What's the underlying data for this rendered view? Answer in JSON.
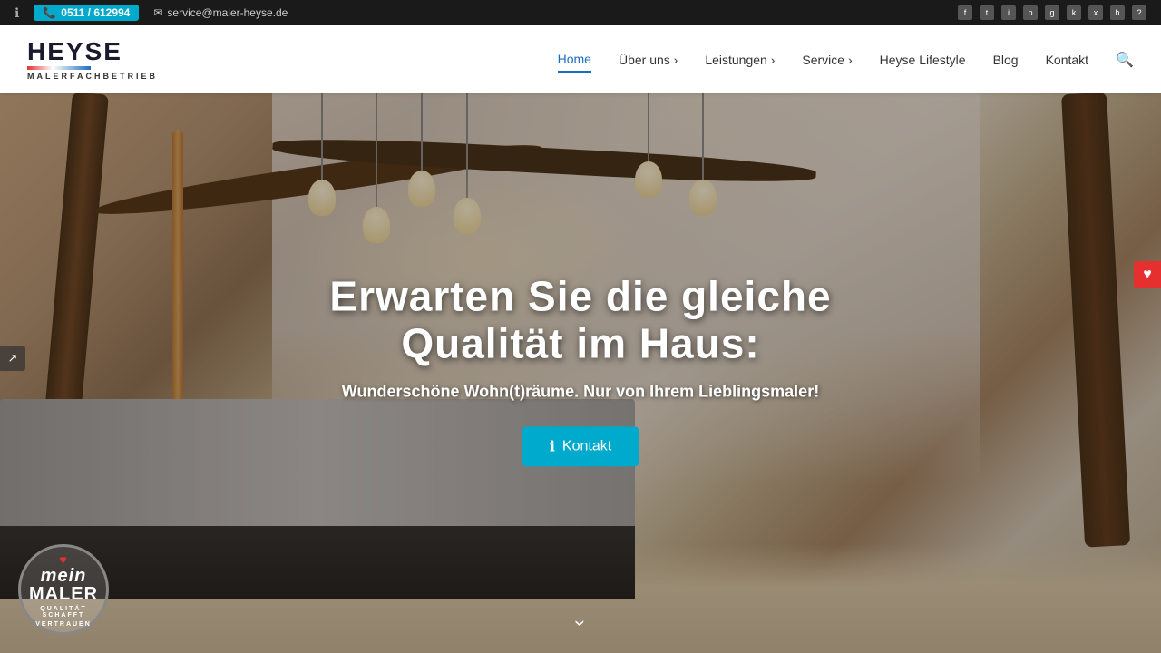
{
  "topbar": {
    "phone": "0511 / 612994",
    "email": "service@maler-heyse.de",
    "info_icon": "ℹ",
    "phone_icon": "📞",
    "email_icon": "✉",
    "socials": [
      "f",
      "t",
      "i",
      "p",
      "g",
      "k",
      "x",
      "h",
      "?"
    ]
  },
  "header": {
    "logo_name": "HEYSE",
    "logo_sub": "MALERFACHBETRIEB",
    "nav": [
      {
        "label": "Home",
        "active": true
      },
      {
        "label": "Über uns ›",
        "active": false
      },
      {
        "label": "Leistungen ›",
        "active": false
      },
      {
        "label": "Service ›",
        "active": false
      },
      {
        "label": "Heyse Lifestyle",
        "active": false
      },
      {
        "label": "Blog",
        "active": false
      },
      {
        "label": "Kontakt",
        "active": false
      }
    ],
    "search_icon": "🔍"
  },
  "hero": {
    "title_line1": "Erwarten Sie die gleiche",
    "title_line2": "Qualität im Haus:",
    "subtitle": "Wunderschöne Wohn(t)räume. Nur von Ihrem Lieblingsmaler!",
    "cta_label": "Kontakt",
    "cta_icon": "ℹ",
    "share_icon": "↗",
    "wishlist_icon": "♥",
    "scroll_icon": "❯",
    "badge_heart": "♥",
    "badge_mein": "mein",
    "badge_maler": "MALER",
    "badge_sub1": "QUALITÄT SCHAFFT",
    "badge_sub2": "VERTRAUEN"
  }
}
